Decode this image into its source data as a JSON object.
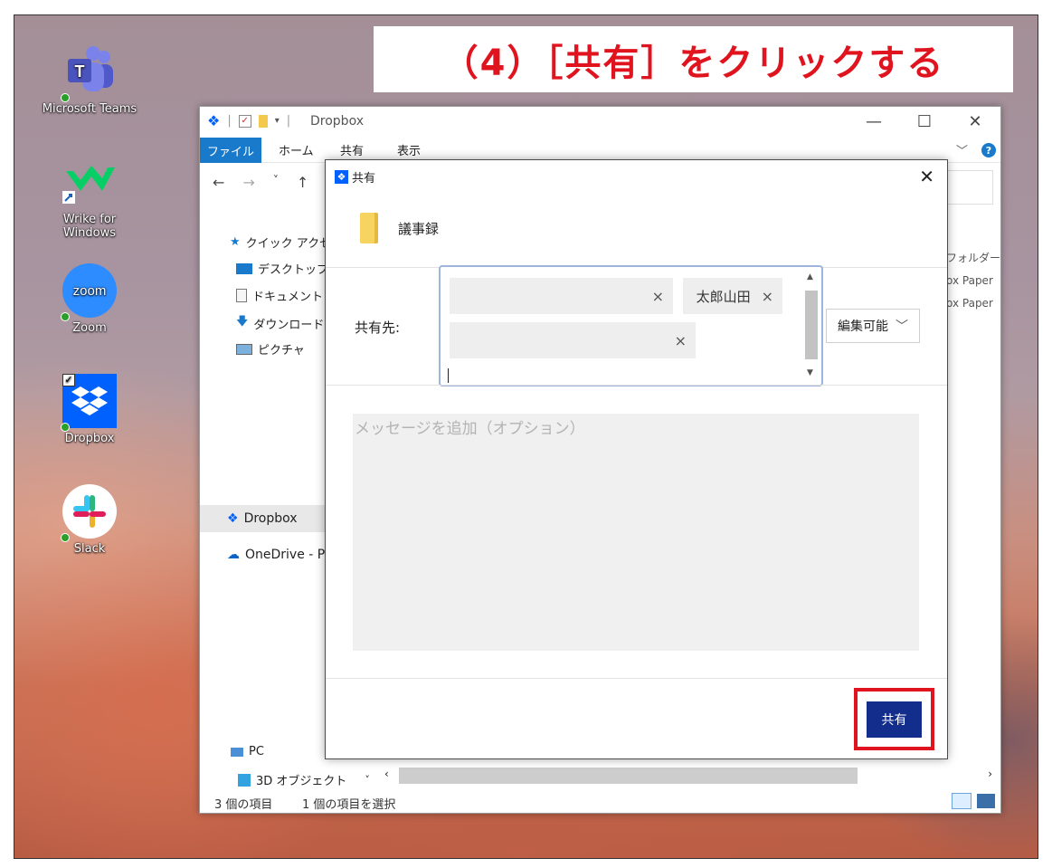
{
  "banner": {
    "text": "（4）［共有］をクリックする"
  },
  "desktop_icons": [
    {
      "label": "Microsoft Teams",
      "icon": "teams-icon"
    },
    {
      "label": "Wrike for Windows",
      "icon": "wrike-icon"
    },
    {
      "label": "Zoom",
      "icon": "zoom-icon",
      "glyph": "zoom"
    },
    {
      "label": "Dropbox",
      "icon": "dropbox-icon"
    },
    {
      "label": "Slack",
      "icon": "slack-icon"
    }
  ],
  "explorer": {
    "title": "Dropbox",
    "window_buttons": {
      "minimize": "—",
      "maximize": "☐",
      "close": "✕"
    },
    "ribbon": {
      "file": "ファイル",
      "home": "ホーム",
      "share": "共有",
      "view": "表示",
      "collapse": "﹀",
      "help": "?"
    },
    "nav": {
      "back": "←",
      "forward": "→",
      "recent": "˅",
      "up": "↑"
    },
    "sidebar": {
      "quick_access": "クイック アクセス",
      "desktop": "デスクトップ",
      "documents": "ドキュメント",
      "downloads": "ダウンロード",
      "pictures": "ピクチャ",
      "dropbox": "Dropbox",
      "onedrive": "OneDrive - P",
      "pc": "PC",
      "objects3d": "3D オブジェクト"
    },
    "right_column": [
      "フォルダー",
      "ox Paper",
      "ox Paper"
    ],
    "status": {
      "count": "3 個の項目",
      "selected": "1 個の項目を選択"
    }
  },
  "dialog": {
    "title": "共有",
    "close": "✕",
    "folder_name": "議事録",
    "share_to_label": "共有先:",
    "recipients": [
      {
        "name": "",
        "remove": "×"
      },
      {
        "name": "太郎山田",
        "remove": "×"
      },
      {
        "name": "",
        "remove": "×"
      }
    ],
    "permission": {
      "value": "編集可能",
      "arrow": "﹀"
    },
    "message_placeholder": "メッセージを追加（オプション）",
    "share_button": "共有"
  },
  "colors": {
    "banner_text": "#e0141e",
    "share_button": "#122d8c",
    "highlight": "#e0141e",
    "file_tab": "#1979ca"
  }
}
